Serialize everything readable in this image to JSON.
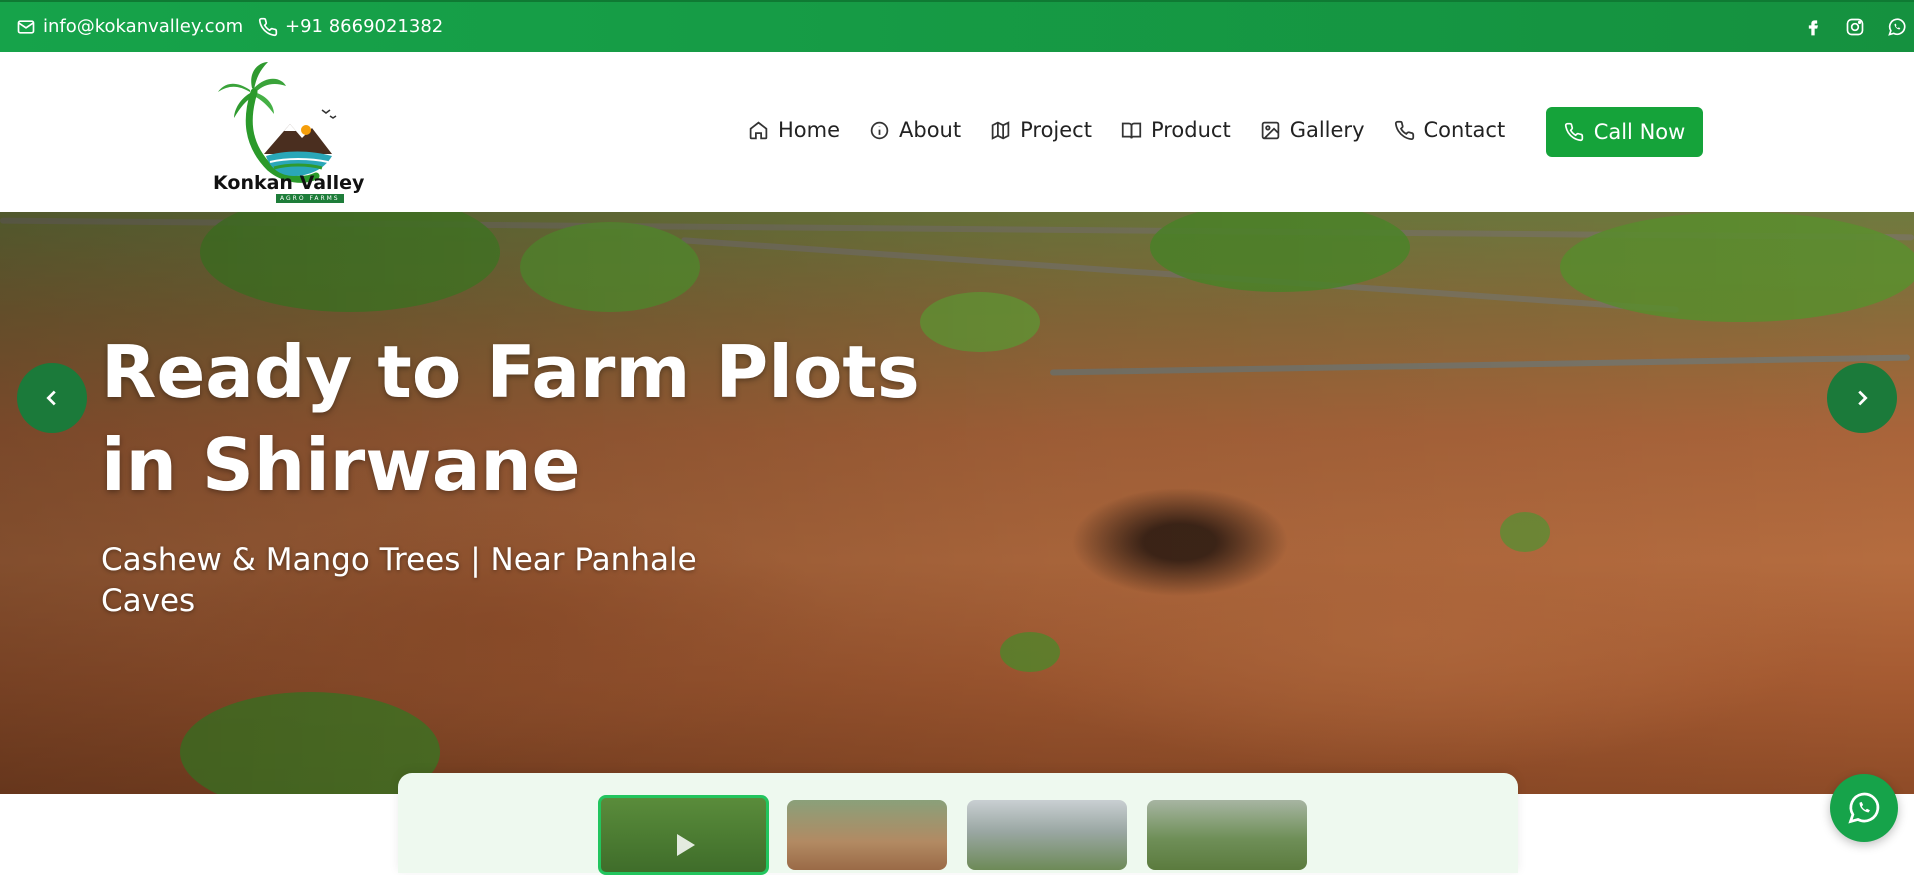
{
  "topbar": {
    "email": "info@kokanvalley.com",
    "phone": "+91 8669021382",
    "socials": [
      "facebook-icon",
      "instagram-icon",
      "whatsapp-icon"
    ]
  },
  "brand": {
    "name": "Konkan Valley",
    "tagline": "AGRO FARMS"
  },
  "nav": {
    "items": [
      {
        "label": "Home",
        "icon": "home-icon"
      },
      {
        "label": "About",
        "icon": "info-icon"
      },
      {
        "label": "Project",
        "icon": "map-icon"
      },
      {
        "label": "Product",
        "icon": "book-icon"
      },
      {
        "label": "Gallery",
        "icon": "image-icon"
      },
      {
        "label": "Contact",
        "icon": "phone-icon"
      }
    ],
    "cta": "Call Now"
  },
  "hero": {
    "title_line1": "Ready to Farm Plots",
    "title_line2": "in Shirwane",
    "subtitle": "Cashew & Mango Trees | Near Panhale Caves"
  },
  "colors": {
    "brand_green": "#16a34a",
    "arrow_green": "#1b7a3a",
    "thumb_strip_bg": "#eef9ef"
  }
}
